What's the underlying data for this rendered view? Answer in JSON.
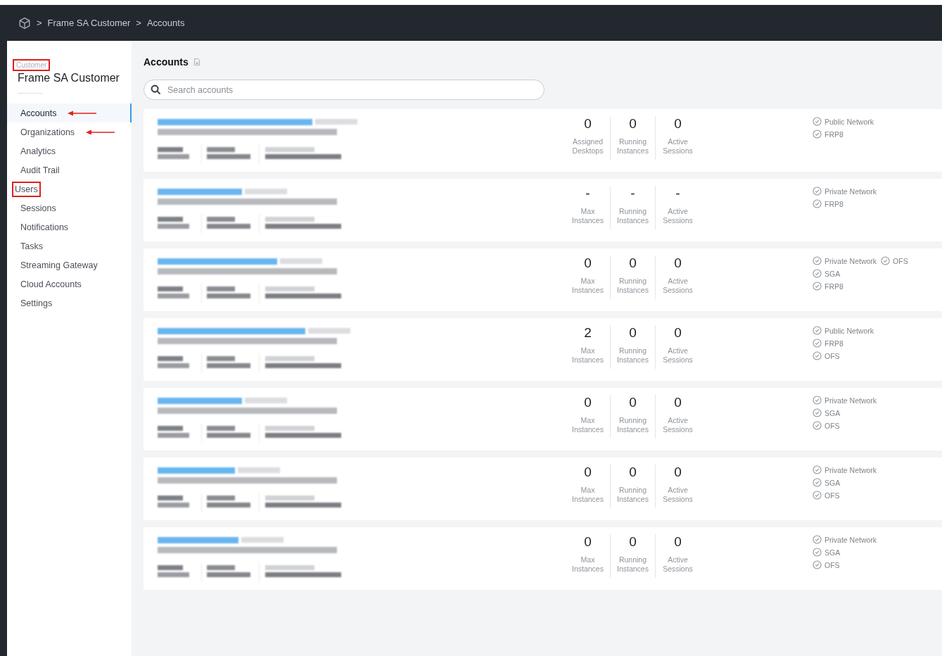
{
  "breadcrumb": {
    "items": [
      "Frame SA Customer",
      "Accounts"
    ],
    "separator": ">"
  },
  "sidebar": {
    "caption": {
      "text": "Customer",
      "highlighted": true
    },
    "title": "Frame SA Customer",
    "items": [
      {
        "label": "Accounts",
        "selected": true,
        "highlighted": false,
        "arrow": true
      },
      {
        "label": "Organizations",
        "selected": false,
        "highlighted": false,
        "arrow": true
      },
      {
        "label": "Analytics",
        "selected": false,
        "highlighted": false,
        "arrow": false
      },
      {
        "label": "Audit Trail",
        "selected": false,
        "highlighted": false,
        "arrow": false
      },
      {
        "label": "Users",
        "selected": false,
        "highlighted": true,
        "arrow": false
      },
      {
        "label": "Sessions",
        "selected": false,
        "highlighted": false,
        "arrow": false
      },
      {
        "label": "Notifications",
        "selected": false,
        "highlighted": false,
        "arrow": false
      },
      {
        "label": "Tasks",
        "selected": false,
        "highlighted": false,
        "arrow": false
      },
      {
        "label": "Streaming Gateway",
        "selected": false,
        "highlighted": false,
        "arrow": false
      },
      {
        "label": "Cloud Accounts",
        "selected": false,
        "highlighted": false,
        "arrow": false
      },
      {
        "label": "Settings",
        "selected": false,
        "highlighted": false,
        "arrow": false
      }
    ]
  },
  "page": {
    "title": "Accounts",
    "search": {
      "placeholder": "Search accounts"
    }
  },
  "accounts": [
    {
      "stats": [
        {
          "value": "0",
          "label": "Assigned Desktops"
        },
        {
          "value": "0",
          "label": "Running Instances"
        },
        {
          "value": "0",
          "label": "Active Sessions"
        }
      ],
      "features": [
        [
          "Public Network"
        ],
        [
          "FRP8"
        ]
      ]
    },
    {
      "stats": [
        {
          "value": "-",
          "label": "Max Instances"
        },
        {
          "value": "-",
          "label": "Running Instances"
        },
        {
          "value": "-",
          "label": "Active Sessions"
        }
      ],
      "features": [
        [
          "Private Network"
        ],
        [
          "FRP8"
        ]
      ]
    },
    {
      "stats": [
        {
          "value": "0",
          "label": "Max Instances"
        },
        {
          "value": "0",
          "label": "Running Instances"
        },
        {
          "value": "0",
          "label": "Active Sessions"
        }
      ],
      "features": [
        [
          "Private Network",
          "OFS"
        ],
        [
          "SGA"
        ],
        [
          "FRP8"
        ]
      ]
    },
    {
      "stats": [
        {
          "value": "2",
          "label": "Max Instances"
        },
        {
          "value": "0",
          "label": "Running Instances"
        },
        {
          "value": "0",
          "label": "Active Sessions"
        }
      ],
      "features": [
        [
          "Public Network"
        ],
        [
          "FRP8"
        ],
        [
          "OFS"
        ]
      ]
    },
    {
      "stats": [
        {
          "value": "0",
          "label": "Max Instances"
        },
        {
          "value": "0",
          "label": "Running Instances"
        },
        {
          "value": "0",
          "label": "Active Sessions"
        }
      ],
      "features": [
        [
          "Private Network"
        ],
        [
          "SGA"
        ],
        [
          "OFS"
        ]
      ]
    },
    {
      "stats": [
        {
          "value": "0",
          "label": "Max Instances"
        },
        {
          "value": "0",
          "label": "Running Instances"
        },
        {
          "value": "0",
          "label": "Active Sessions"
        }
      ],
      "features": [
        [
          "Private Network"
        ],
        [
          "SGA"
        ],
        [
          "OFS"
        ]
      ]
    },
    {
      "stats": [
        {
          "value": "0",
          "label": "Max Instances"
        },
        {
          "value": "0",
          "label": "Running Instances"
        },
        {
          "value": "0",
          "label": "Active Sessions"
        }
      ],
      "features": [
        [
          "Private Network"
        ],
        [
          "SGA"
        ],
        [
          "OFS"
        ]
      ]
    }
  ]
}
